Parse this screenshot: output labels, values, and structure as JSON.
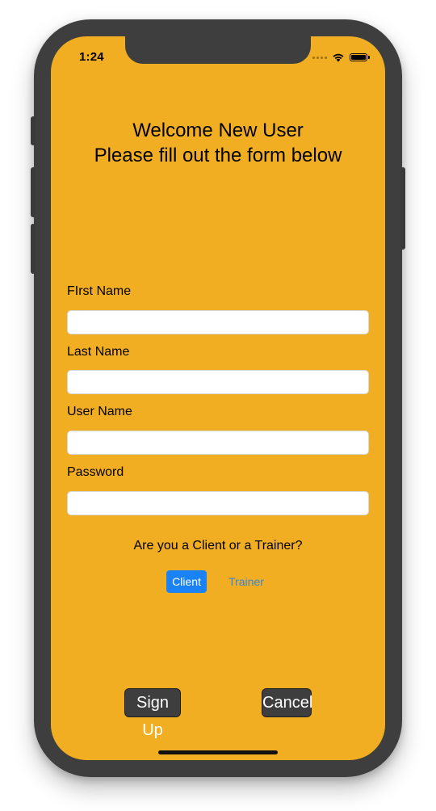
{
  "status_bar": {
    "time": "1:24",
    "icons": [
      "cellular-signal-icon",
      "wifi-icon",
      "battery-icon"
    ]
  },
  "header": {
    "line1": "Welcome New User",
    "line2": "Please fill out the form below"
  },
  "form": {
    "first_name_label": "FIrst Name",
    "first_name_value": "",
    "last_name_label": "Last Name",
    "last_name_value": "",
    "user_name_label": "User Name",
    "user_name_value": "",
    "password_label": "Password",
    "password_value": ""
  },
  "role": {
    "question": "Are you a Client or a Trainer?",
    "options": [
      "Client",
      "Trainer"
    ],
    "selected": "Client"
  },
  "actions": {
    "sign_up_label": "Sign Up",
    "cancel_label": "Cancel"
  },
  "colors": {
    "background": "#f2ae23",
    "device_frame": "#3e3e3e",
    "segment_selected": "#1a82f5",
    "button_background": "#3e3e3e"
  }
}
